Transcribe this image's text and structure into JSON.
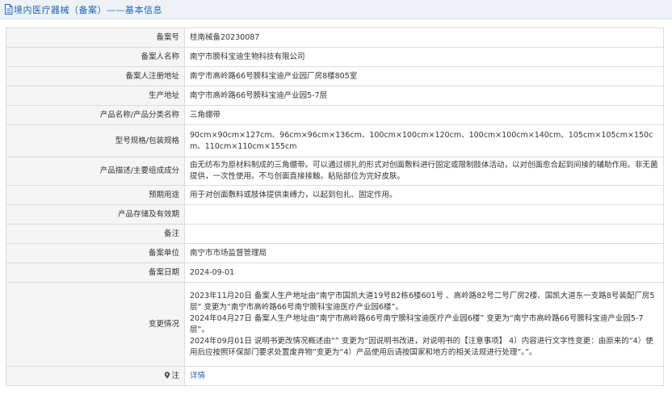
{
  "header": {
    "title": "境内医疗器械（备案）——基本信息"
  },
  "rows": {
    "record_no": {
      "label": "备案号",
      "value": "桂南械备20230087"
    },
    "registrant": {
      "label": "备案人名称",
      "value": "南宁市膀科宝迪生物科技有限公司"
    },
    "reg_address": {
      "label": "备案人注册地址",
      "value": "南宁市高岭路66号膀科宝迪产业园厂房8楼805室"
    },
    "prod_address": {
      "label": "生产地址",
      "value": "南宁市高岭路66号膀科宝迪产业园5-7层"
    },
    "product_name": {
      "label": "产品名称/产品分类名称",
      "value": "三角绷带"
    },
    "model": {
      "label": "型号规格/包装规格",
      "value": "90cm×90cm×127cm、96cm×96cm×136cm、100cm×100cm×120cm、100cm×100cm×140cm、105cm×105cm×150cm、110cm×110cm×155cm"
    },
    "description": {
      "label": "产品描述/主要组成成分",
      "value": "由无纺布为原材料制成的三角绷带。可以通过绑扎的形式对创面敷料进行固定或限制肢体活动，以对创面愈合起到间接的辅助作用。非无菌提供，一次性使用。不与创面直接接触。粘贴部位为完好皮肤。"
    },
    "intended_use": {
      "label": "预期用途",
      "value": "用于对创面敷料或肢体提供束缚力，以起到包扎、固定作用。"
    },
    "storage": {
      "label": "产品存储及有效期",
      "value": ""
    },
    "remark": {
      "label": "备注",
      "value": ""
    },
    "unit": {
      "label": "备案单位",
      "value": "南宁市市场监督管理局"
    },
    "date": {
      "label": "备案日期",
      "value": "2024-09-01"
    },
    "changes": {
      "label": "变更情况",
      "lines": [
        "2023年11月20日 备案人生产地址由“南宁市国凯大道19号B2栋6楼601号 、高岭路82号二号厂房2楼、国凯大道东一支路8号装配厂房5层” 变更为“南宁市高岭路66号南宁膀科宝迪医疗产业园6楼”。",
        "2024年04月27日 备案人生产地址由“南宁市高岭路66号南宁膀科宝迪医疗产业园6楼” 变更为“南宁市高岭路66号膀科宝迪产业园5-7层”。",
        "2024年09月01日 说明书更改情况概述由“” 变更为“因说明书改进，对说明书的【注意事项】 4）内容进行文字性变更：由原来的“4）使用后应按照环保部门要求处置废弃物”变更为“4）产品使用后请按国家和地方的相关法规进行处理”。”。"
      ]
    },
    "note": {
      "label": "注",
      "link": "详情"
    }
  }
}
